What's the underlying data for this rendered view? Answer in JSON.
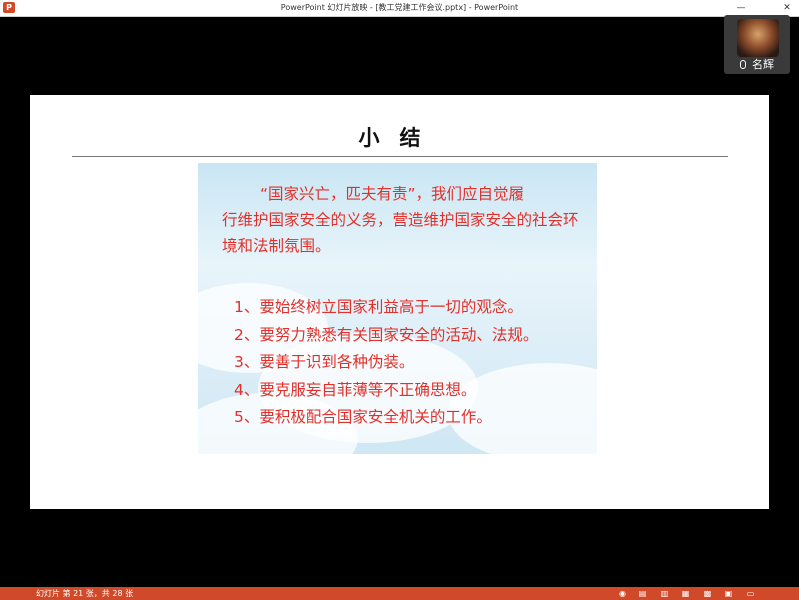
{
  "window": {
    "app_badge": "P",
    "title": "PowerPoint 幻灯片放映 - [教工党建工作会议.pptx] - PowerPoint",
    "min_glyph": "—",
    "close_glyph": "✕"
  },
  "slide": {
    "title": "小结",
    "paragraph_lead": "“国家兴亡，匹夫有责”，我们应自觉履",
    "paragraph_rest": "行维护国家安全的义务，营造维护国家安全的社会环境和法制氛围。",
    "items": [
      "1、要始终树立国家利益高于一切的观念。",
      "2、要努力熟悉有关国家安全的活动、法规。",
      "3、要善于识到各种伪装。",
      "4、要克服妄自菲薄等不正确思想。",
      "5、要积极配合国家安全机关的工作。"
    ]
  },
  "webcam": {
    "name": "名辉"
  },
  "status": {
    "slide_counter": "幻灯片 第 21 张，共 28 张",
    "accent_color": "#d04a2a"
  },
  "icons": [
    "powerpoint-icon",
    "minimize-icon",
    "close-icon",
    "microphone-icon",
    "normal-view-icon",
    "slide-sorter-icon",
    "reading-view-icon",
    "slideshow-icon"
  ]
}
